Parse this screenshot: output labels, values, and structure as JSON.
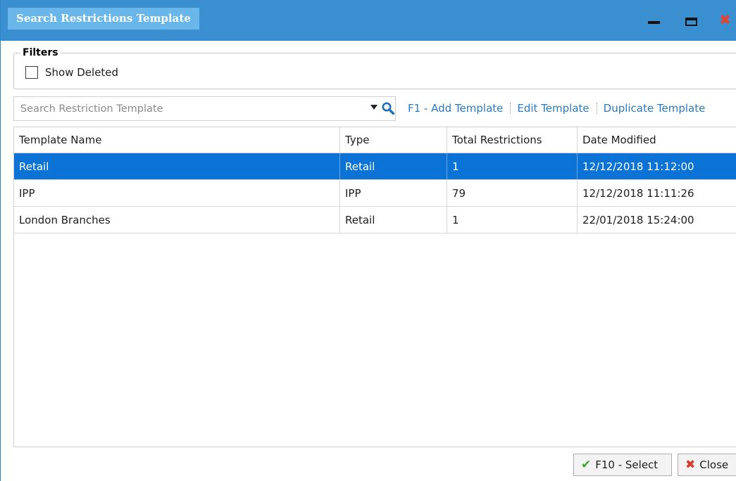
{
  "window": {
    "title": "Search Restrictions Template"
  },
  "filters": {
    "legend": "Filters",
    "show_deleted_label": "Show Deleted",
    "show_deleted_checked": false
  },
  "search": {
    "placeholder": "Search Restriction Template",
    "value": ""
  },
  "toolbar": {
    "add_label": "F1 - Add Template",
    "edit_label": "Edit Template",
    "duplicate_label": "Duplicate Template"
  },
  "grid": {
    "columns": [
      "Template Name",
      "Type",
      "Total Restrictions",
      "Date Modified"
    ],
    "rows": [
      {
        "name": "Retail",
        "type": "Retail",
        "total": "1",
        "modified": "12/12/2018 11:12:00",
        "selected": true
      },
      {
        "name": "IPP",
        "type": "IPP",
        "total": "79",
        "modified": "12/12/2018 11:11:26",
        "selected": false
      },
      {
        "name": "London Branches",
        "type": "Retail",
        "total": "1",
        "modified": "22/01/2018 15:24:00",
        "selected": false
      }
    ]
  },
  "footer": {
    "select_label": "F10 - Select",
    "close_label": "Close"
  },
  "icons": {
    "minimize": "minimize-icon",
    "maximize": "maximize-icon",
    "close": "close-icon",
    "dropdown": "chevron-down-icon",
    "search": "search-icon",
    "check": "check-icon",
    "cross": "x-icon"
  },
  "colors": {
    "titlebar": "#3a8fd0",
    "title_tab": "#69b6ea",
    "selection": "#0b73d6",
    "link": "#2a7bc1",
    "close_red": "#e8432e",
    "check_green": "#3aa535"
  }
}
